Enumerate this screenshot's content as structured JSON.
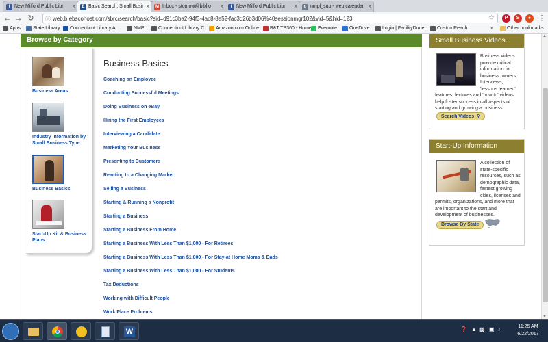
{
  "browser": {
    "tabs": [
      {
        "label": "New Milford Public Libr",
        "icon": "library-icon",
        "color": "#3b5998",
        "glyph": "f",
        "active": false
      },
      {
        "label": "Basic Search: Small Busir",
        "icon": "ebsco-icon",
        "color": "#1d4f91",
        "glyph": "E",
        "active": true
      },
      {
        "label": "Inbox - stomow@biblio",
        "icon": "gmail-icon",
        "color": "#d44638",
        "glyph": "M",
        "active": false
      },
      {
        "label": "New Milford Public Libr",
        "icon": "facebook-icon",
        "color": "#3b5998",
        "glyph": "f",
        "active": false
      },
      {
        "label": "nmpl_sup - web calendar",
        "icon": "globe-icon",
        "color": "#6c7a89",
        "glyph": "o",
        "active": false
      }
    ],
    "url": "web.b.ebscohost.com/sbrc/search/basic?sid=d91c3ba2-94f3-4ac8-8e52-fac3d26b3d06%40sessionmgr102&vid=5&hid=123",
    "bookmarks": [
      {
        "label": "Apps",
        "color": "#555555"
      },
      {
        "label": "State Library",
        "color": "#4a6fa5"
      },
      {
        "label": "Connecticut Library A",
        "color": "#1a4fa0"
      },
      {
        "label": "NMPL",
        "color": "#555555"
      },
      {
        "label": "Connecticut Library C",
        "color": "#555555"
      },
      {
        "label": "Amazon.com Online",
        "color": "#f0a000"
      },
      {
        "label": "B&T TS360 - Home",
        "color": "#c03030"
      },
      {
        "label": "Evernote",
        "color": "#2dbe60"
      },
      {
        "label": "OneDrive",
        "color": "#2f6fd0"
      },
      {
        "label": "Login | FacilityDude",
        "color": "#555555"
      },
      {
        "label": "CustomReach",
        "color": "#555555"
      }
    ],
    "bookmarks_overflow": "»",
    "other_bookmarks": "Other bookmarks"
  },
  "browse": {
    "header": "Browse by Category",
    "categories": [
      {
        "label": "Business Areas"
      },
      {
        "label": "Industry Information by Small Business Type"
      },
      {
        "label": "Business Basics"
      },
      {
        "label": "Start-Up Kit & Business Plans"
      }
    ]
  },
  "content": {
    "title": "Business Basics",
    "topics": [
      "Coaching an Employee",
      "Conducting Successful Meetings",
      "Doing Business on eBay",
      "Hiring the First Employees",
      "Interviewing a Candidate",
      "Marketing Your Business",
      "Presenting to Customers",
      "Reacting to a Changing Market",
      "Selling a Business",
      "Starting & Running a Nonprofit",
      "Starting a Business",
      "Starting a Business From Home",
      "Starting a Business With Less Than $1,000 - For Retirees",
      "Starting a Business With Less Than $1,000 - For Stay-at Home Moms & Dads",
      "Starting a Business With Less Than $1,000 - For Students",
      "Tax Deductions",
      "Working with Difficult People",
      "Work Place Problems"
    ]
  },
  "sidebar": {
    "videos": {
      "title": "Small Business Videos",
      "text_lines": [
        "Business videos",
        "provide critical",
        "information for",
        "business owners.",
        "Interviews,",
        "'lessons learned'",
        "features, lectures and 'how to' videos",
        "help foster success in all aspects of",
        "starting and growing a business."
      ],
      "button": "Search Videos"
    },
    "startup": {
      "title": "Start-Up Information",
      "text_lines": [
        "A collection of",
        "state-specific",
        "resources, such as",
        "demographic data,",
        "fastest growing",
        "cities, licenses and",
        "permits, organizations, and more that",
        "are important to the start and",
        "development of businesses."
      ],
      "button": "Browse By State"
    }
  },
  "taskbar": {
    "time": "11:25 AM",
    "date": "6/22/2017"
  }
}
